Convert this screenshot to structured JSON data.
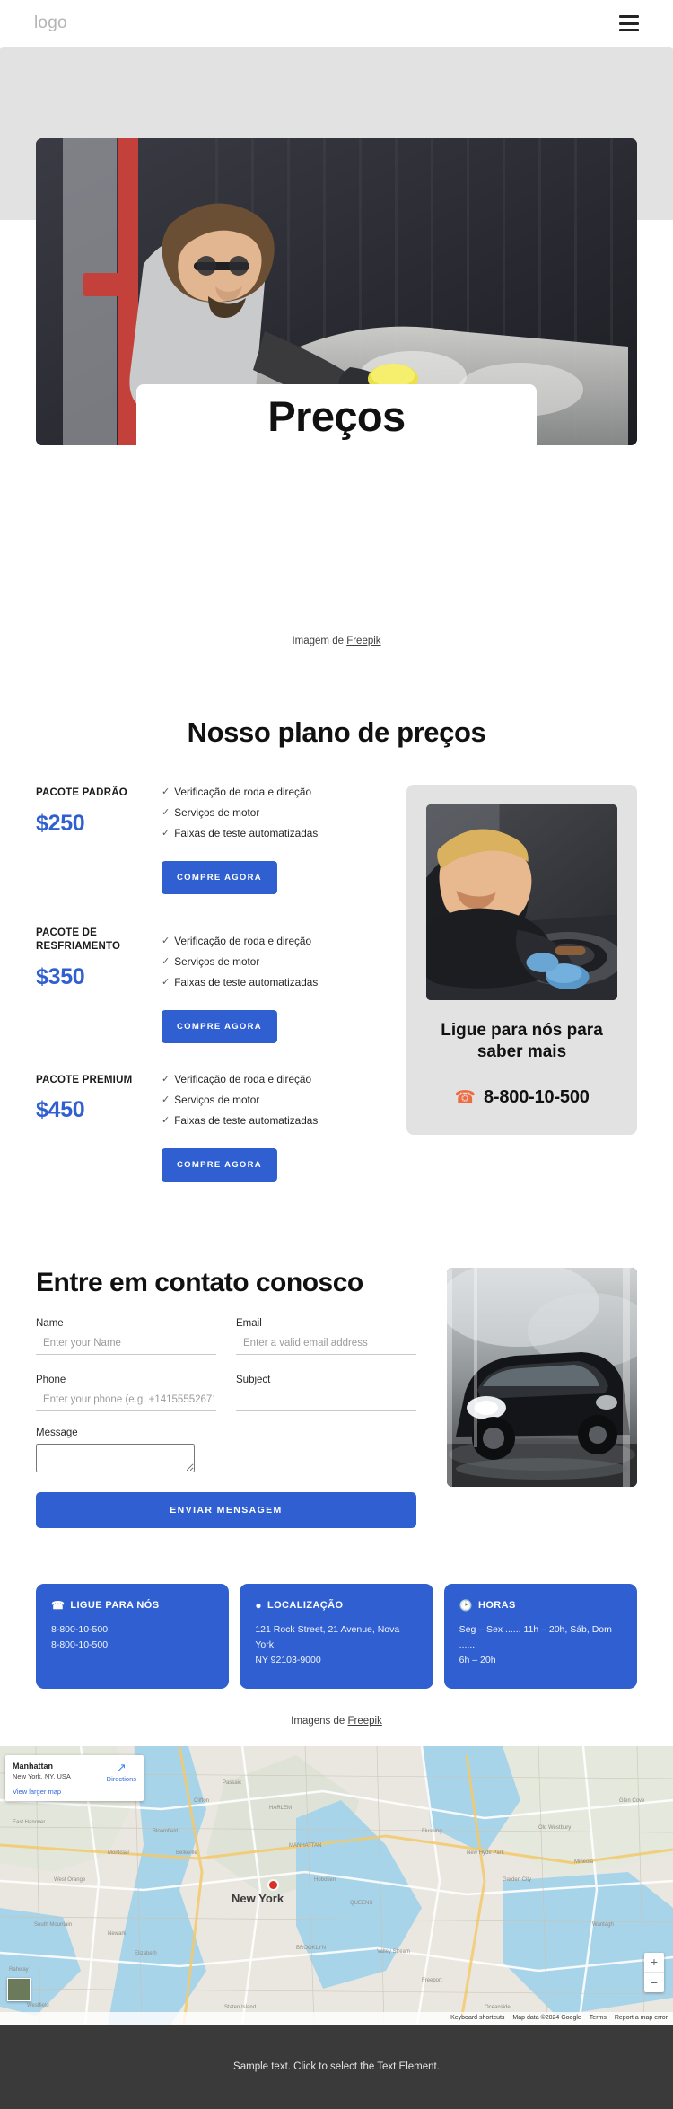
{
  "header": {
    "logo": "logo",
    "menu_label": "menu"
  },
  "hero": {
    "title": "Preços",
    "credit_prefix": "Imagem de ",
    "credit_link": "Freepik"
  },
  "pricing": {
    "section_title": "Nosso plano de preços",
    "plans": [
      {
        "name": "PACOTE PADRÃO",
        "price": "$250",
        "features": [
          "Verificação de roda e direção",
          "Serviços de motor",
          "Faixas de teste automatizadas"
        ],
        "cta": "COMPRE AGORA"
      },
      {
        "name": "PACOTE DE RESFRIAMENTO",
        "price": "$350",
        "features": [
          "Verificação de roda e direção",
          "Serviços de motor",
          "Faixas de teste automatizadas"
        ],
        "cta": "COMPRE AGORA"
      },
      {
        "name": "PACOTE PREMIUM",
        "price": "$450",
        "features": [
          "Verificação de roda e direção",
          "Serviços de motor",
          "Faixas de teste automatizadas"
        ],
        "cta": "COMPRE AGORA"
      }
    ],
    "call_card": {
      "title": "Ligue para nós para saber mais",
      "phone": "8-800-10-500",
      "phone_icon": "phone-icon"
    }
  },
  "contact": {
    "title": "Entre em contato conosco",
    "fields": {
      "name_label": "Name",
      "name_placeholder": "Enter your Name",
      "email_label": "Email",
      "email_placeholder": "Enter a valid email address",
      "phone_label": "Phone",
      "phone_placeholder": "Enter your phone (e.g. +14155552671)",
      "subject_label": "Subject",
      "subject_placeholder": "",
      "message_label": "Message",
      "message_placeholder": ""
    },
    "submit": "ENVIAR MENSAGEM"
  },
  "info_cards": [
    {
      "icon": "phone-icon",
      "title": "LIGUE PARA NÓS",
      "line1": "8-800-10-500,",
      "line2": "8-800-10-500"
    },
    {
      "icon": "location-pin-icon",
      "title": "LOCALIZAÇÃO",
      "line1": "121 Rock Street, 21 Avenue, Nova York,",
      "line2": "NY 92103-9000"
    },
    {
      "icon": "clock-icon",
      "title": "HORAS",
      "line1": "Seg – Sex ...... 11h – 20h, Sáb, Dom  ......",
      "line2": "6h – 20h"
    }
  ],
  "images_credit": {
    "prefix": "Imagens de ",
    "link": "Freepik"
  },
  "map": {
    "place_name": "Manhattan",
    "place_address": "New York, NY, USA",
    "view_larger": "View larger map",
    "directions": "Directions",
    "city_label": "New York",
    "zoom_in": "+",
    "zoom_out": "−",
    "attribution": {
      "shortcuts": "Keyboard shortcuts",
      "map_data": "Map data ©2024 Google",
      "terms": "Terms",
      "report": "Report a map error"
    }
  },
  "footer": {
    "text": "Sample text. Click to select the Text Element."
  },
  "colors": {
    "accent_blue": "#2f5fd0",
    "phone_orange": "#f06a3f",
    "band_gray": "#e2e2e2",
    "footer_gray": "#3a3a3a"
  }
}
